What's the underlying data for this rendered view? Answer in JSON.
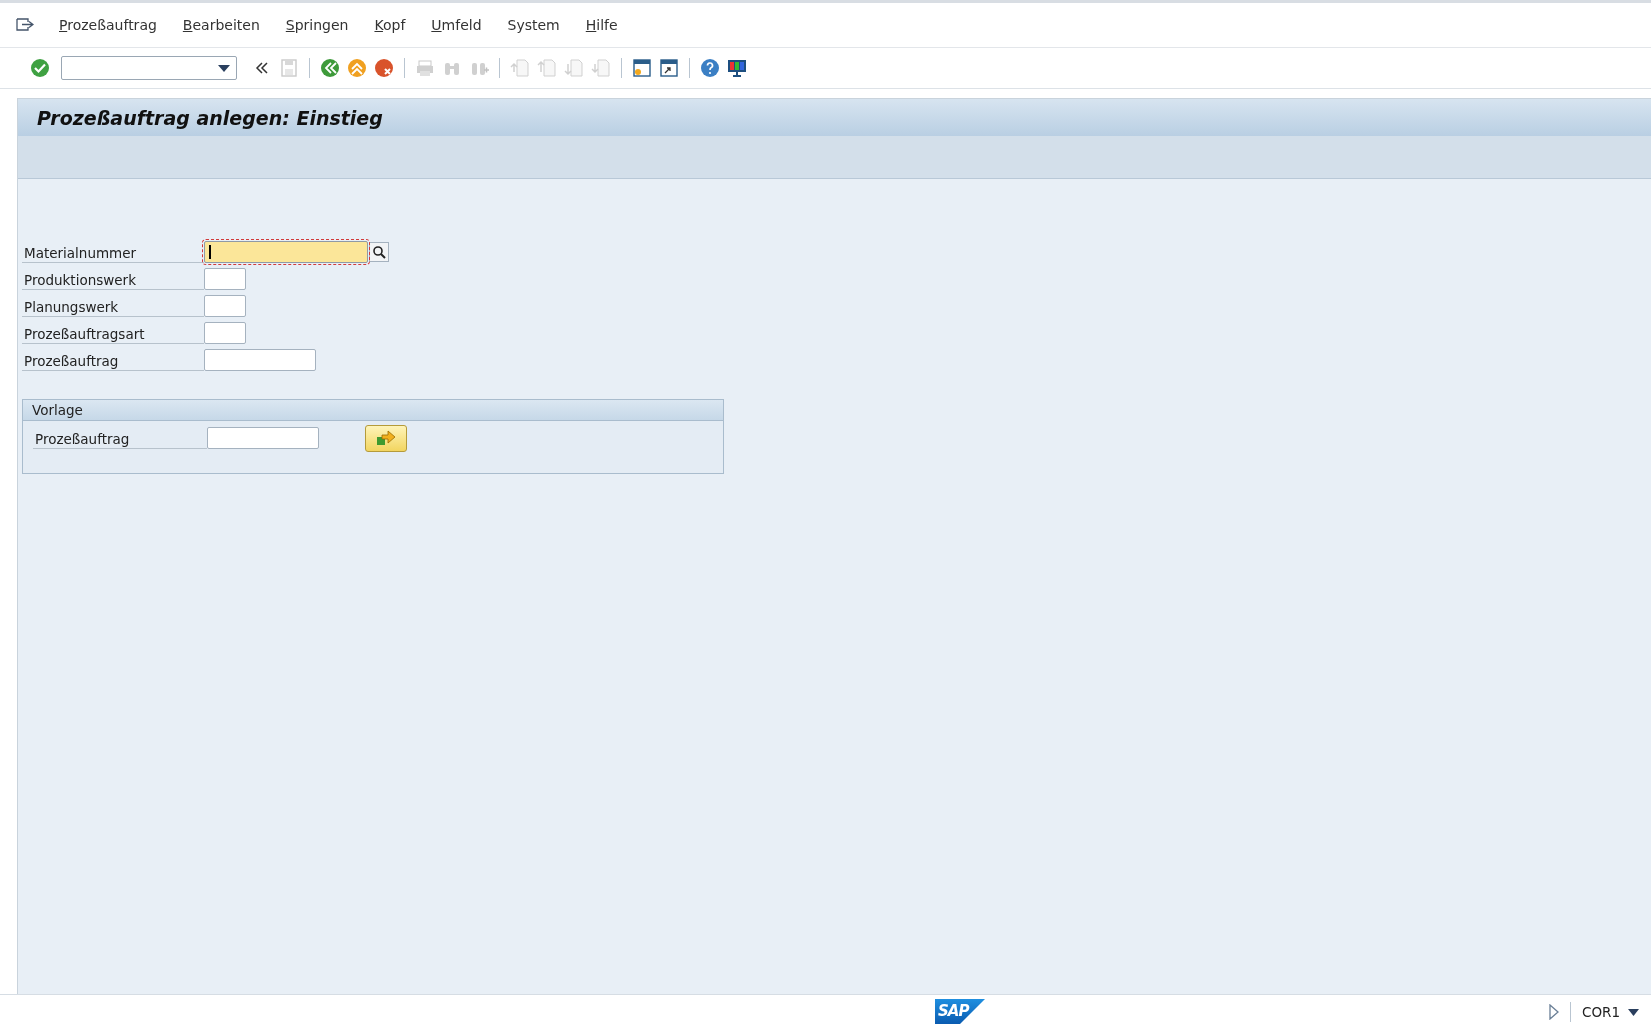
{
  "menu": [
    {
      "label": "Prozeßauftrag",
      "mnemonic": true
    },
    {
      "label": "Bearbeiten",
      "mnemonic": true
    },
    {
      "label": "Springen",
      "mnemonic": true
    },
    {
      "label": "Kopf",
      "mnemonic": true
    },
    {
      "label": "Umfeld",
      "mnemonic": true
    },
    {
      "label": "System",
      "mnemonic": false
    },
    {
      "label": "Hilfe",
      "mnemonic": true
    }
  ],
  "title": "Prozeßauftrag anlegen: Einstieg",
  "fields": [
    {
      "label": "Materialnummer",
      "kind": "search",
      "required": true,
      "focused": true
    },
    {
      "label": "Produktionswerk",
      "kind": "short",
      "required": false,
      "focused": false
    },
    {
      "label": "Planungswerk",
      "kind": "short",
      "required": false,
      "focused": false
    },
    {
      "label": "Prozeßauftragsart",
      "kind": "short",
      "required": false,
      "focused": false
    },
    {
      "label": "Prozeßauftrag",
      "kind": "long",
      "required": false,
      "focused": false
    }
  ],
  "group": {
    "title": "Vorlage",
    "fields": [
      {
        "label": "Prozeßauftrag",
        "kind": "long"
      }
    ]
  },
  "status_bar": {
    "logo": "SAP",
    "transaction": "COR1"
  }
}
